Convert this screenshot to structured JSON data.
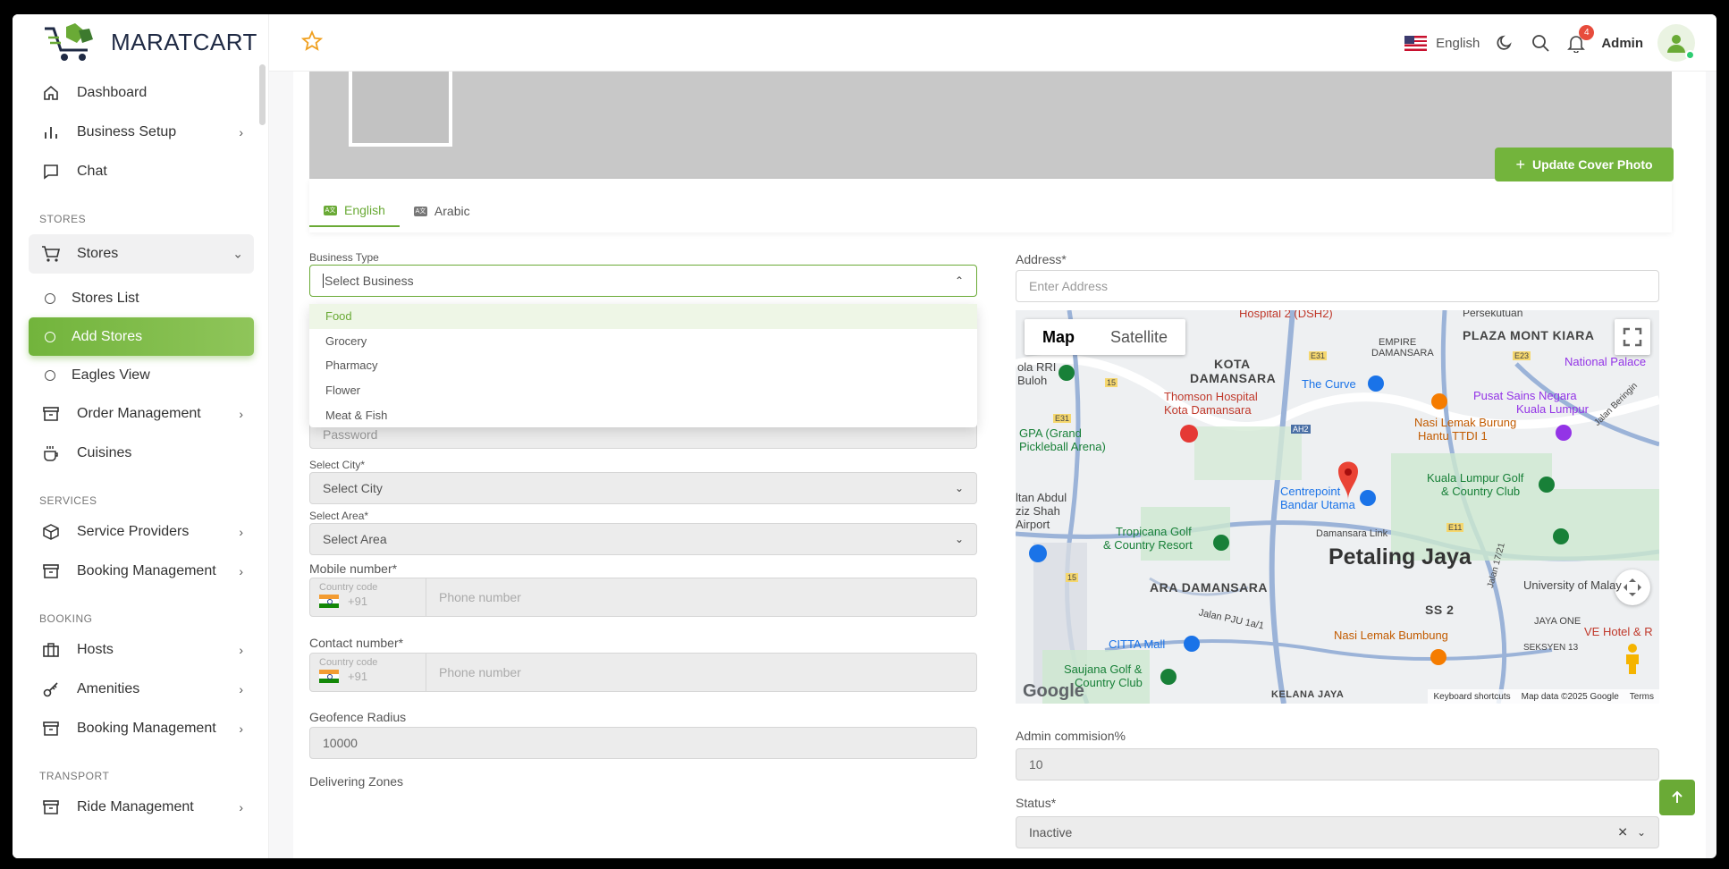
{
  "brand": {
    "name": "MARATCART"
  },
  "header": {
    "language": "English",
    "notification_count": "4",
    "admin_name": "Admin"
  },
  "sidebar": {
    "items": [
      {
        "label": "Dashboard",
        "icon": "home-icon"
      },
      {
        "label": "Business Setup",
        "icon": "bar-chart-icon"
      },
      {
        "label": "Chat",
        "icon": "chat-icon"
      }
    ],
    "sections": {
      "stores": "STORES",
      "services": "SERVICES",
      "booking": "BOOKING",
      "transport": "TRANSPORT"
    },
    "stores_group": {
      "label": "Stores",
      "sub": [
        "Stores List",
        "Add Stores",
        "Eagles View"
      ],
      "active": "Add Stores"
    },
    "stores_items": [
      {
        "label": "Order Management",
        "icon": "archive-icon"
      },
      {
        "label": "Cuisines",
        "icon": "cup-icon"
      }
    ],
    "services_items": [
      {
        "label": "Service Providers",
        "icon": "box-icon"
      },
      {
        "label": "Booking Management",
        "icon": "archive-icon"
      }
    ],
    "booking_items": [
      {
        "label": "Hosts",
        "icon": "briefcase-icon"
      },
      {
        "label": "Amenities",
        "icon": "key-icon"
      },
      {
        "label": "Booking Management",
        "icon": "archive-icon"
      }
    ],
    "transport_items": [
      {
        "label": "Ride Management",
        "icon": "archive-icon"
      }
    ]
  },
  "main": {
    "update_cover_label": "Update Cover Photo",
    "tabs": [
      {
        "label": "English",
        "active": true
      },
      {
        "label": "Arabic",
        "active": false
      }
    ],
    "business_type": {
      "label": "Business Type",
      "placeholder": "Select Business",
      "options": [
        "Food",
        "Grocery",
        "Pharmacy",
        "Flower",
        "Meat & Fish"
      ],
      "highlighted": "Food"
    },
    "password": {
      "placeholder": "Password"
    },
    "city": {
      "label": "Select City*",
      "value": "Select City"
    },
    "area": {
      "label": "Select Area*",
      "value": "Select Area"
    },
    "mobile": {
      "label": "Mobile number*",
      "cc_label": "Country code",
      "cc_value": "+91",
      "placeholder": "Phone number"
    },
    "contact": {
      "label": "Contact number*",
      "cc_label": "Country code",
      "cc_value": "+91",
      "placeholder": "Phone number"
    },
    "geofence": {
      "label": "Geofence Radius",
      "value": "10000"
    },
    "delivering_zones": {
      "label": "Delivering Zones"
    },
    "address": {
      "label": "Address*",
      "placeholder": "Enter Address"
    },
    "admin_commission": {
      "label": "Admin commision%",
      "value": "10"
    },
    "status": {
      "label": "Status*",
      "value": "Inactive"
    }
  },
  "map": {
    "tabs": [
      "Map",
      "Satellite"
    ],
    "active_tab": "Map",
    "labels": {
      "hospital2": "Hospital 2 (DSH2)",
      "persekutuan": "Persekutuan",
      "empire": "EMPIRE",
      "damansara": "DAMANSARA",
      "plaza_mont_kiara": "PLAZA MONT KIARA",
      "kota": "KOTA",
      "kota_damansara": "DAMANSARA",
      "national_palace": "National Palace",
      "ola_rri": "ola RRI",
      "buloh": "Buloh",
      "thomson1": "Thomson Hospital",
      "thomson2": "Kota Damansara",
      "the_curve": "The Curve",
      "pusat1": "Pusat Sains Negara",
      "pusat2": "Kuala Lumpur",
      "gpa1": "GPA (Grand",
      "gpa2": "Pickleball Arena)",
      "nasi1": "Nasi Lemak Burung",
      "nasi2": "Hantu TTDI 1",
      "jalan_beringin": "Jalan Beringin",
      "kl_golf1": "Kuala Lumpur Golf",
      "kl_golf2": "& Country Club",
      "centrepoint1": "Centrepoint",
      "centrepoint2": "Bandar Utama",
      "sultan1": "ltan Abdul",
      "sultan2": "ziz Shah",
      "sultan3": "Airport",
      "tropicana1": "Tropicana Golf",
      "tropicana2": "& Country Resort",
      "damansara_link": "Damansara Link",
      "petaling_jaya": "Petaling Jaya",
      "ara_damansara": "ARA DAMANSARA",
      "university": "University of Malay",
      "ss2": "SS 2",
      "jalan_pju": "Jalan PJU 1a/1",
      "jalan_17": "Jalan 17/21",
      "jaya_one": "JAYA ONE",
      "ve_hotel": "VE Hotel & R",
      "nasi_bumbung": "Nasi Lemak Bumbung",
      "citta": "CITTA Mall",
      "seksyen": "SEKSYEN 13",
      "saujana1": "Saujana Golf &",
      "saujana2": "Country Club",
      "kelana_jaya": "KELANA JAYA",
      "google": "Google"
    },
    "roads": [
      "E31",
      "15",
      "AH2",
      "E23",
      "E11",
      "E31",
      "15"
    ],
    "footer": [
      "Keyboard shortcuts",
      "Map data ©2025 Google",
      "Terms"
    ]
  },
  "colors": {
    "accent": "#73b43c",
    "accent_dark": "#6aaa36",
    "badge": "#e74c3c",
    "pin": "#ea4335"
  }
}
